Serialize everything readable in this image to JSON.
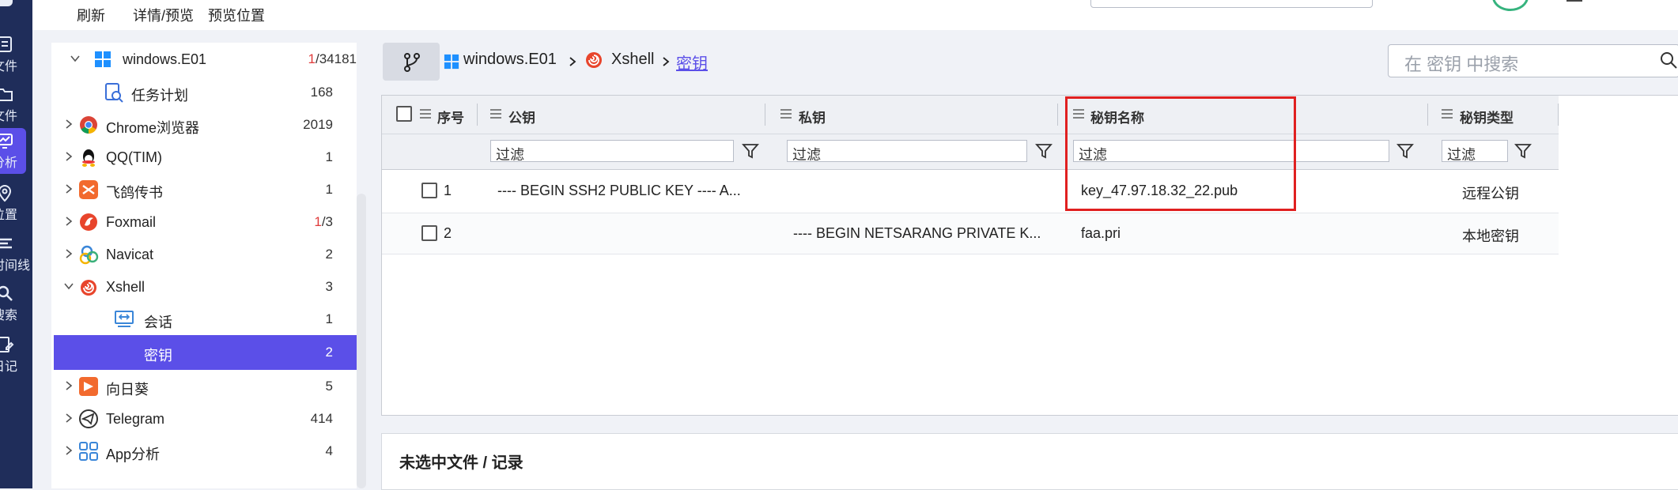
{
  "toolbar": {
    "refresh": "刷新",
    "detail_preview": "详情/预览",
    "preview_position": "预览位置"
  },
  "rail": [
    {
      "label": "文件",
      "icon": "document-icon"
    },
    {
      "label": "文件",
      "icon": "folder-icon"
    },
    {
      "label": "分析",
      "icon": "analysis-icon",
      "active": true
    },
    {
      "label": "位置",
      "icon": "location-pin-icon"
    },
    {
      "label": "时间线",
      "icon": "timeline-icon"
    },
    {
      "label": "搜索",
      "icon": "search-icon"
    },
    {
      "label": "日记",
      "icon": "notes-icon"
    }
  ],
  "tree": {
    "root": {
      "label": "windows.E01",
      "count_red": "1",
      "count_rest": "/34181"
    },
    "items": [
      {
        "label": "任务计划",
        "count": "168",
        "icon": "task-scheduler-icon"
      },
      {
        "label": "Chrome浏览器",
        "count": "2019",
        "icon": "chrome-icon"
      },
      {
        "label": "QQ(TIM)",
        "count": "1",
        "icon": "qq-icon"
      },
      {
        "label": "飞鸽传书",
        "count": "1",
        "icon": "feige-icon"
      },
      {
        "label": "Foxmail",
        "count_red": "1",
        "count_rest": "/3",
        "icon": "foxmail-icon"
      },
      {
        "label": "Navicat",
        "count": "2",
        "icon": "navicat-icon"
      },
      {
        "label": "Xshell",
        "count": "3",
        "icon": "xshell-icon"
      },
      {
        "label": "会话",
        "count": "1",
        "icon": "session-icon"
      },
      {
        "label": "密钥",
        "count": "2",
        "icon": "key-icon"
      },
      {
        "label": "向日葵",
        "count": "5",
        "icon": "sunlogin-icon"
      },
      {
        "label": "Telegram",
        "count": "414",
        "icon": "telegram-icon"
      },
      {
        "label": "App分析",
        "count": "4",
        "icon": "app-analysis-icon"
      }
    ]
  },
  "breadcrumb": {
    "root": "windows.E01",
    "app": "Xshell",
    "current": "密钥"
  },
  "search": {
    "placeholder": "在 密钥 中搜索"
  },
  "grid": {
    "headers": {
      "index": "序号",
      "public_key": "公钥",
      "private_key": "私钥",
      "key_name": "秘钥名称",
      "key_type": "秘钥类型"
    },
    "filter_placeholder": "过滤",
    "rows": [
      {
        "index": "1",
        "public_key": "---- BEGIN SSH2 PUBLIC KEY ---- A...",
        "private_key": "",
        "key_name": "key_47.97.18.32_22.pub",
        "key_type": "远程公钥"
      },
      {
        "index": "2",
        "public_key": "",
        "private_key": "---- BEGIN NETSARANG PRIVATE K...",
        "key_name": "faa.pri",
        "key_type": "本地密钥"
      }
    ]
  },
  "detail": {
    "title": "未选中文件 / 记录"
  },
  "colors": {
    "accent": "#5b4fe8",
    "rail_bg": "#1f2d5a",
    "highlight_box": "#e02020",
    "count_red": "#e03b3b"
  }
}
